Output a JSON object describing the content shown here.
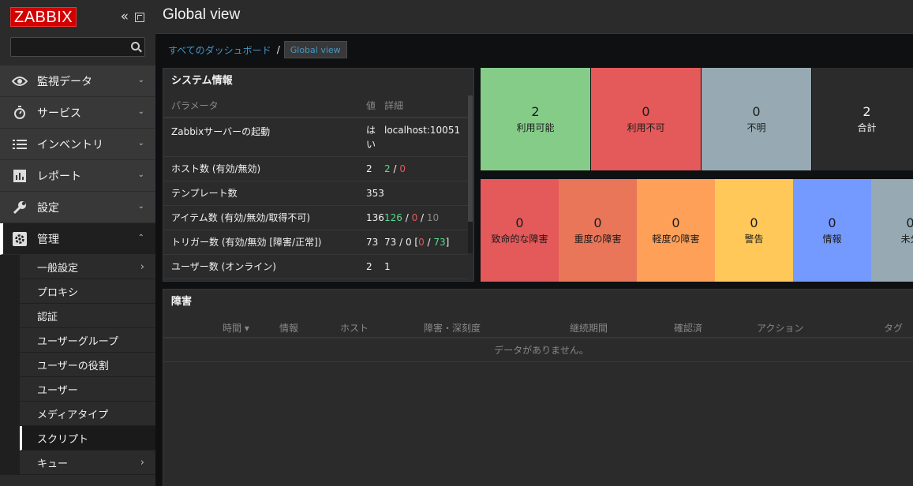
{
  "app": {
    "logo": "ZABBIX"
  },
  "header": {
    "title": "Global view"
  },
  "sidebar": {
    "menu": [
      {
        "label": "監視データ",
        "icon": "eye-icon"
      },
      {
        "label": "サービス",
        "icon": "stopwatch-icon"
      },
      {
        "label": "インベントリ",
        "icon": "list-icon"
      },
      {
        "label": "レポート",
        "icon": "bar-chart-icon"
      },
      {
        "label": "設定",
        "icon": "wrench-icon"
      },
      {
        "label": "管理",
        "icon": "gear-icon"
      }
    ],
    "admin_submenu": [
      {
        "label": "一般設定",
        "has_arrow": true
      },
      {
        "label": "プロキシ"
      },
      {
        "label": "認証"
      },
      {
        "label": "ユーザーグループ"
      },
      {
        "label": "ユーザーの役割"
      },
      {
        "label": "ユーザー"
      },
      {
        "label": "メディアタイプ"
      },
      {
        "label": "スクリプト",
        "selected": true
      },
      {
        "label": "キュー",
        "has_arrow": true
      }
    ]
  },
  "breadcrumb": {
    "parent": "すべてのダッシュボード",
    "separator": "/",
    "current": "Global view"
  },
  "system_info": {
    "title": "システム情報",
    "columns": [
      "パラメータ",
      "値",
      "詳細"
    ],
    "rows": [
      {
        "param": "Zabbixサーバーの起動",
        "value_line1": "は",
        "value_line2": "い",
        "detail": "localhost:10051"
      },
      {
        "param": "ホスト数 (有効/無効)",
        "value": "2",
        "d1": "2",
        "d_sep": " / ",
        "d2": "0"
      },
      {
        "param": "テンプレート数",
        "value": "353"
      },
      {
        "param": "アイテム数 (有効/無効/取得不可)",
        "value": "136",
        "d1": "126",
        "d_sep": " / ",
        "d2": "0",
        "d_sep2": " / ",
        "d3": "10"
      },
      {
        "param": "トリガー数 (有効/無効 [障害/正常])",
        "value": "73",
        "d_pre": "73 / 0 [",
        "d1": "0",
        "d_sep": " / ",
        "d2": "73",
        "d_post": "]"
      },
      {
        "param": "ユーザー数 (オンライン)",
        "value": "2",
        "d1": "1"
      }
    ]
  },
  "host_availability": [
    {
      "count": "2",
      "label": "利用可能",
      "color": "#86cc89"
    },
    {
      "count": "0",
      "label": "利用不可",
      "color": "#e45959"
    },
    {
      "count": "0",
      "label": "不明",
      "color": "#97aab3"
    },
    {
      "count": "2",
      "label": "合計",
      "color": "#2b2b2b"
    }
  ],
  "problems_by_severity": [
    {
      "count": "0",
      "label": "致命的な障害",
      "color": "#e45959"
    },
    {
      "count": "0",
      "label": "重度の障害",
      "color": "#e97659"
    },
    {
      "count": "0",
      "label": "軽度の障害",
      "color": "#ffa059"
    },
    {
      "count": "0",
      "label": "警告",
      "color": "#ffc859"
    },
    {
      "count": "0",
      "label": "情報",
      "color": "#7499ff"
    },
    {
      "count": "0",
      "label": "未分",
      "color": "#97aab3"
    }
  ],
  "problems": {
    "title": "障害",
    "columns": [
      "時間 ▾",
      "情報",
      "ホスト",
      "障害・深刻度",
      "継続期間",
      "確認済",
      "アクション",
      "タグ"
    ],
    "empty_text": "データがありません。"
  }
}
